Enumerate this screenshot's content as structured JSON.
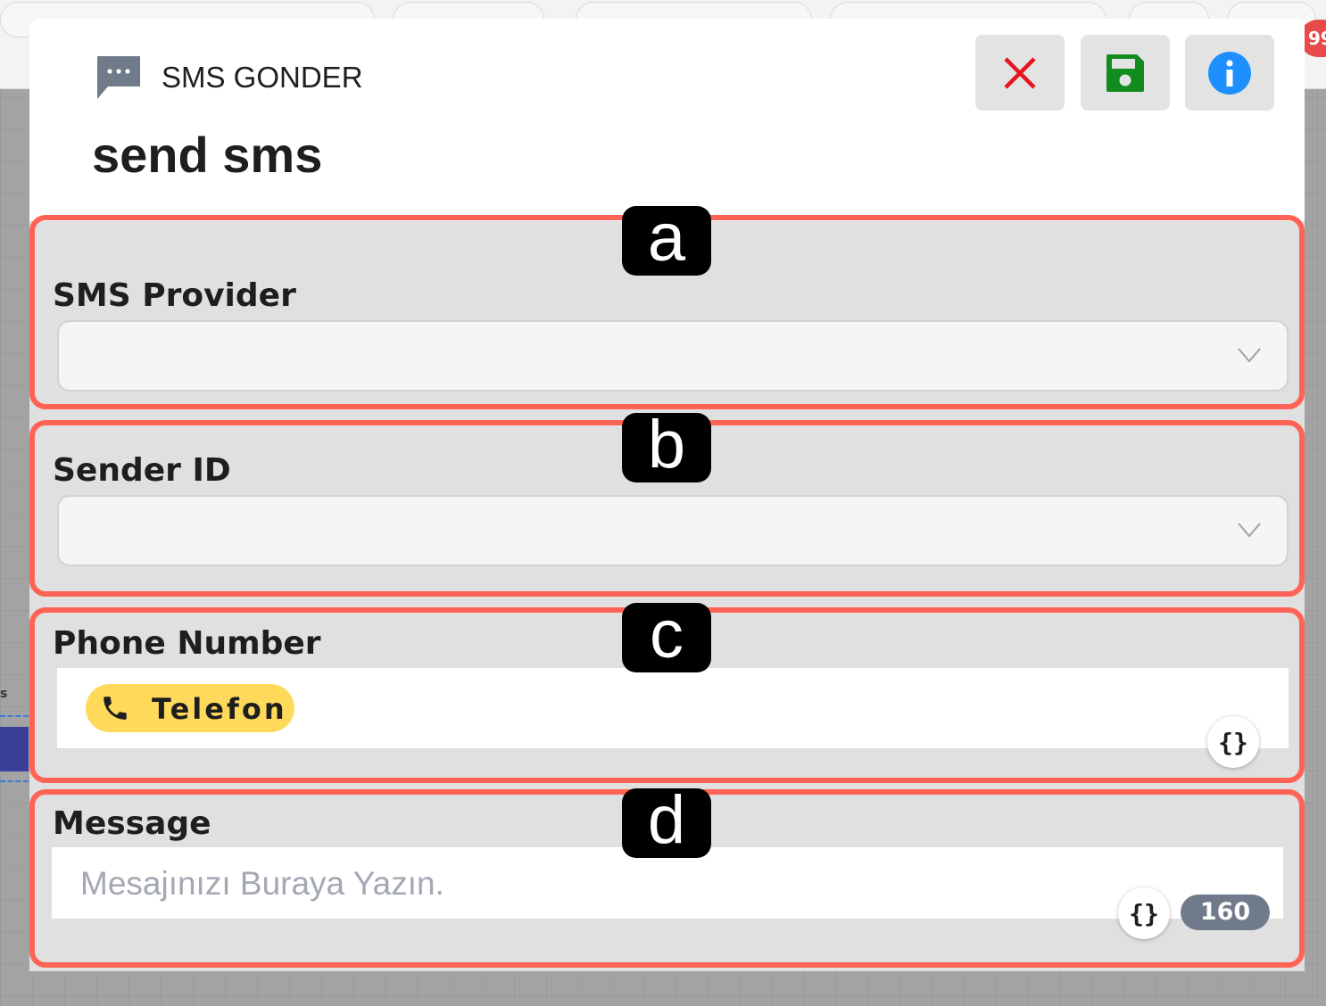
{
  "background": {
    "badge_count": "99",
    "side_label": "s"
  },
  "header": {
    "title": "SMS GONDER",
    "subtitle": "send sms",
    "icons": {
      "app": "sms-chat-icon",
      "close": "close-icon",
      "save": "save-icon",
      "info": "info-icon"
    }
  },
  "colors": {
    "accent_red": "#ff6355",
    "close_red": "#e8141e",
    "save_green": "#128c1e",
    "info_blue": "#1e8fff",
    "chip_yellow": "#ffd95a",
    "counter_gray": "#6f7b8b"
  },
  "form": {
    "sms_provider": {
      "marker": "a",
      "label": "SMS Provider",
      "value": ""
    },
    "sender_id": {
      "marker": "b",
      "label": "Sender ID",
      "value": ""
    },
    "phone_number": {
      "marker": "c",
      "label": "Phone Number",
      "chip_label": "Telefon",
      "variable_button": "{}"
    },
    "message": {
      "marker": "d",
      "label": "Message",
      "placeholder": "Mesajınızı Buraya Yazın.",
      "variable_button": "{}",
      "char_count": "160"
    }
  }
}
